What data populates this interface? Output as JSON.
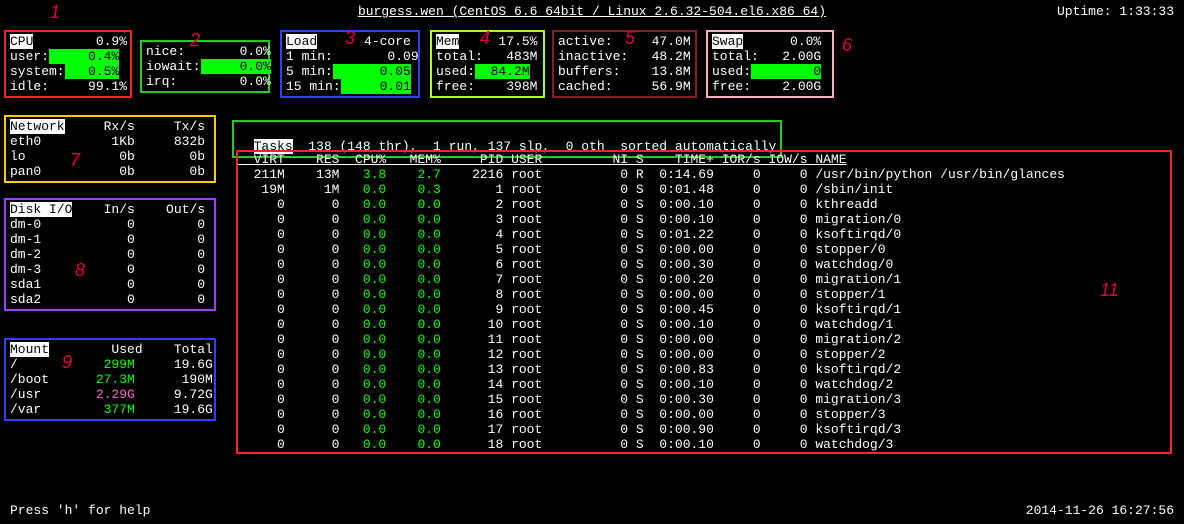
{
  "header": {
    "host": "burgess.wen",
    "os": "(CentOS 6.6 64bit / Linux 2.6.32-504.el6.x86_64)",
    "uptime_label": "Uptime:",
    "uptime": "1:33:33"
  },
  "cpu": {
    "title": "CPU",
    "total": "0.9%",
    "user_l": "user:",
    "user": "0.4%",
    "system_l": "system:",
    "system": "0.5%",
    "idle_l": "idle:",
    "idle": "99.1%"
  },
  "cpu2": {
    "nice_l": "nice:",
    "nice": "0.0%",
    "iowait_l": "iowait:",
    "iowait": "0.0%",
    "irq_l": "irq:",
    "irq": "0.0%"
  },
  "load": {
    "title": "Load",
    "core": "4-core",
    "m1_l": "1 min:",
    "m1": "0.09",
    "m5_l": "5 min:",
    "m5": "0.05",
    "m15_l": "15 min:",
    "m15": "0.01"
  },
  "mem": {
    "title": "Mem",
    "pct": "17.5%",
    "total_l": "total:",
    "total": "483M",
    "used_l": "used:",
    "used": "84.2M",
    "free_l": "free:",
    "free": "398M"
  },
  "mem2": {
    "active_l": "active:",
    "active": "47.0M",
    "inactive_l": "inactive:",
    "inactive": "48.2M",
    "buffers_l": "buffers:",
    "buffers": "13.8M",
    "cached_l": "cached:",
    "cached": "56.9M"
  },
  "swap": {
    "title": "Swap",
    "pct": "0.0%",
    "total_l": "total:",
    "total": "2.00G",
    "used_l": "used:",
    "used": "0",
    "free_l": "free:",
    "free": "2.00G"
  },
  "network": {
    "title": "Network",
    "rx": "Rx/s",
    "tx": "Tx/s",
    "rows": [
      {
        "if": "eth0",
        "rx": "1Kb",
        "tx": "832b"
      },
      {
        "if": "lo",
        "rx": "0b",
        "tx": "0b"
      },
      {
        "if": "pan0",
        "rx": "0b",
        "tx": "0b"
      }
    ]
  },
  "disk": {
    "title": "Disk I/O",
    "in": "In/s",
    "out": "Out/s",
    "rows": [
      {
        "d": "dm-0",
        "in": "0",
        "out": "0"
      },
      {
        "d": "dm-1",
        "in": "0",
        "out": "0"
      },
      {
        "d": "dm-2",
        "in": "0",
        "out": "0"
      },
      {
        "d": "dm-3",
        "in": "0",
        "out": "0"
      },
      {
        "d": "sda1",
        "in": "0",
        "out": "0"
      },
      {
        "d": "sda2",
        "in": "0",
        "out": "0"
      }
    ]
  },
  "mount": {
    "title": "Mount",
    "used": "Used",
    "total": "Total",
    "rows": [
      {
        "m": "/",
        "used": "299M",
        "total": "19.6G",
        "c": "txt-green"
      },
      {
        "m": "/boot",
        "used": "27.3M",
        "total": "190M",
        "c": "txt-green"
      },
      {
        "m": "/usr",
        "used": "2.29G",
        "total": "9.72G",
        "c": "txt-pink"
      },
      {
        "m": "/var",
        "used": "377M",
        "total": "19.6G",
        "c": "txt-green"
      }
    ]
  },
  "tasks": {
    "label": "Tasks",
    "text": "138 (148 thr),  1 run, 137 slp,  0 oth  sorted automatically"
  },
  "proc_header": {
    "virt": "VIRT",
    "res": "RES",
    "cpu": "CPU%",
    "mem": "MEM%",
    "pid": "PID",
    "user": "USER",
    "ni": "NI",
    "s": "S",
    "time": "TIME+",
    "ior": "IOR/s",
    "iow": "IOW/s",
    "name": "NAME"
  },
  "procs": [
    {
      "virt": "211M",
      "res": "13M",
      "cpu": "3.8",
      "mem": "2.7",
      "pid": "2216",
      "user": "root",
      "ni": "0",
      "s": "R",
      "time": "0:14.69",
      "ior": "0",
      "iow": "0",
      "name": "/usr/bin/python /usr/bin/glances"
    },
    {
      "virt": "19M",
      "res": "1M",
      "cpu": "0.0",
      "mem": "0.3",
      "pid": "1",
      "user": "root",
      "ni": "0",
      "s": "S",
      "time": "0:01.48",
      "ior": "0",
      "iow": "0",
      "name": "/sbin/init"
    },
    {
      "virt": "0",
      "res": "0",
      "cpu": "0.0",
      "mem": "0.0",
      "pid": "2",
      "user": "root",
      "ni": "0",
      "s": "S",
      "time": "0:00.10",
      "ior": "0",
      "iow": "0",
      "name": "kthreadd"
    },
    {
      "virt": "0",
      "res": "0",
      "cpu": "0.0",
      "mem": "0.0",
      "pid": "3",
      "user": "root",
      "ni": "0",
      "s": "S",
      "time": "0:00.10",
      "ior": "0",
      "iow": "0",
      "name": "migration/0"
    },
    {
      "virt": "0",
      "res": "0",
      "cpu": "0.0",
      "mem": "0.0",
      "pid": "4",
      "user": "root",
      "ni": "0",
      "s": "S",
      "time": "0:01.22",
      "ior": "0",
      "iow": "0",
      "name": "ksoftirqd/0"
    },
    {
      "virt": "0",
      "res": "0",
      "cpu": "0.0",
      "mem": "0.0",
      "pid": "5",
      "user": "root",
      "ni": "0",
      "s": "S",
      "time": "0:00.00",
      "ior": "0",
      "iow": "0",
      "name": "stopper/0"
    },
    {
      "virt": "0",
      "res": "0",
      "cpu": "0.0",
      "mem": "0.0",
      "pid": "6",
      "user": "root",
      "ni": "0",
      "s": "S",
      "time": "0:00.30",
      "ior": "0",
      "iow": "0",
      "name": "watchdog/0"
    },
    {
      "virt": "0",
      "res": "0",
      "cpu": "0.0",
      "mem": "0.0",
      "pid": "7",
      "user": "root",
      "ni": "0",
      "s": "S",
      "time": "0:00.20",
      "ior": "0",
      "iow": "0",
      "name": "migration/1"
    },
    {
      "virt": "0",
      "res": "0",
      "cpu": "0.0",
      "mem": "0.0",
      "pid": "8",
      "user": "root",
      "ni": "0",
      "s": "S",
      "time": "0:00.00",
      "ior": "0",
      "iow": "0",
      "name": "stopper/1"
    },
    {
      "virt": "0",
      "res": "0",
      "cpu": "0.0",
      "mem": "0.0",
      "pid": "9",
      "user": "root",
      "ni": "0",
      "s": "S",
      "time": "0:00.45",
      "ior": "0",
      "iow": "0",
      "name": "ksoftirqd/1"
    },
    {
      "virt": "0",
      "res": "0",
      "cpu": "0.0",
      "mem": "0.0",
      "pid": "10",
      "user": "root",
      "ni": "0",
      "s": "S",
      "time": "0:00.10",
      "ior": "0",
      "iow": "0",
      "name": "watchdog/1"
    },
    {
      "virt": "0",
      "res": "0",
      "cpu": "0.0",
      "mem": "0.0",
      "pid": "11",
      "user": "root",
      "ni": "0",
      "s": "S",
      "time": "0:00.00",
      "ior": "0",
      "iow": "0",
      "name": "migration/2"
    },
    {
      "virt": "0",
      "res": "0",
      "cpu": "0.0",
      "mem": "0.0",
      "pid": "12",
      "user": "root",
      "ni": "0",
      "s": "S",
      "time": "0:00.00",
      "ior": "0",
      "iow": "0",
      "name": "stopper/2"
    },
    {
      "virt": "0",
      "res": "0",
      "cpu": "0.0",
      "mem": "0.0",
      "pid": "13",
      "user": "root",
      "ni": "0",
      "s": "S",
      "time": "0:00.83",
      "ior": "0",
      "iow": "0",
      "name": "ksoftirqd/2"
    },
    {
      "virt": "0",
      "res": "0",
      "cpu": "0.0",
      "mem": "0.0",
      "pid": "14",
      "user": "root",
      "ni": "0",
      "s": "S",
      "time": "0:00.10",
      "ior": "0",
      "iow": "0",
      "name": "watchdog/2"
    },
    {
      "virt": "0",
      "res": "0",
      "cpu": "0.0",
      "mem": "0.0",
      "pid": "15",
      "user": "root",
      "ni": "0",
      "s": "S",
      "time": "0:00.30",
      "ior": "0",
      "iow": "0",
      "name": "migration/3"
    },
    {
      "virt": "0",
      "res": "0",
      "cpu": "0.0",
      "mem": "0.0",
      "pid": "16",
      "user": "root",
      "ni": "0",
      "s": "S",
      "time": "0:00.00",
      "ior": "0",
      "iow": "0",
      "name": "stopper/3"
    },
    {
      "virt": "0",
      "res": "0",
      "cpu": "0.0",
      "mem": "0.0",
      "pid": "17",
      "user": "root",
      "ni": "0",
      "s": "S",
      "time": "0:00.90",
      "ior": "0",
      "iow": "0",
      "name": "ksoftirqd/3"
    },
    {
      "virt": "0",
      "res": "0",
      "cpu": "0.0",
      "mem": "0.0",
      "pid": "18",
      "user": "root",
      "ni": "0",
      "s": "S",
      "time": "0:00.10",
      "ior": "0",
      "iow": "0",
      "name": "watchdog/3"
    }
  ],
  "footer": {
    "help": "Press 'h' for help",
    "time": "2014-11-26 16:27:56"
  },
  "ann": {
    "a1": "1",
    "a2": "2",
    "a3": "3",
    "a4": "4",
    "a5": "5",
    "a6": "6",
    "a7": "7",
    "a8": "8",
    "a9": "9",
    "a11": "11"
  }
}
